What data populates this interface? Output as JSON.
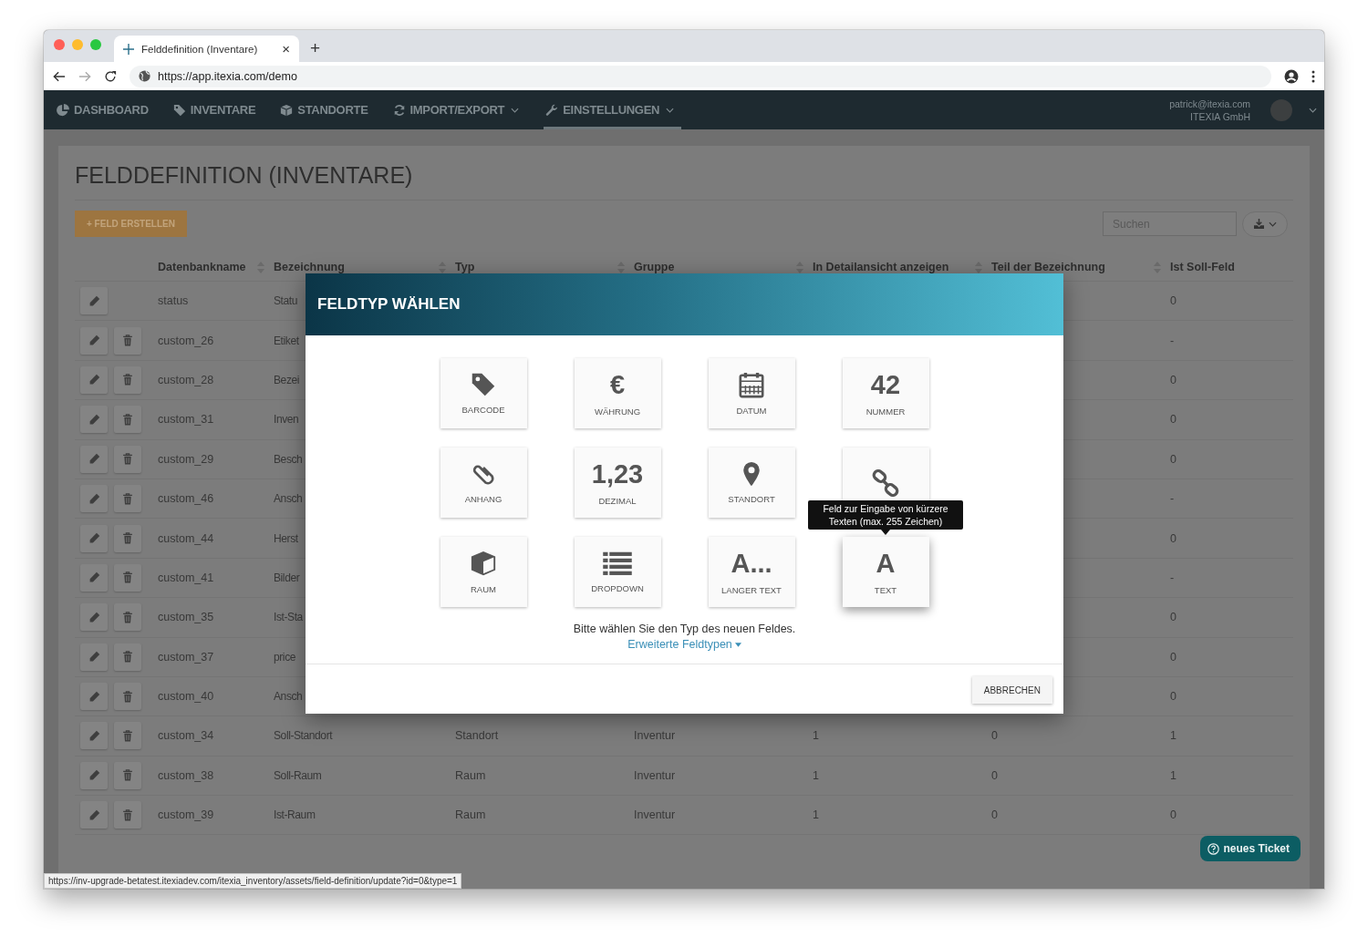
{
  "browser": {
    "tab_title": "Felddefinition (Inventare)",
    "tab_close": "×",
    "new_tab": "+",
    "url": "https://app.itexia.com/demo",
    "status_url": "https://inv-upgrade-betatest.itexiadev.com/itexia_inventory/assets/field-definition/update?id=0&type=1"
  },
  "nav": {
    "items": [
      {
        "label": "DASHBOARD",
        "kind": "dashboard",
        "dropdown": false,
        "selected": false
      },
      {
        "label": "INVENTARE",
        "kind": "inventory",
        "dropdown": false,
        "selected": false
      },
      {
        "label": "STANDORTE",
        "kind": "locations",
        "dropdown": false,
        "selected": false
      },
      {
        "label": "IMPORT/EXPORT",
        "kind": "sync",
        "dropdown": true,
        "selected": false
      },
      {
        "label": "EINSTELLUNGEN",
        "kind": "settings",
        "dropdown": true,
        "selected": true
      }
    ],
    "user": {
      "email": "patrick@itexia.com",
      "company": "ITEXIA GmbH"
    }
  },
  "page": {
    "title": "FELDDEFINITION (INVENTARE)",
    "create_button": "+ FELD ERSTELLEN",
    "search": {
      "placeholder": "Suchen"
    }
  },
  "table": {
    "columns": [
      {
        "label": "Datenbankname",
        "sortable": true
      },
      {
        "label": "Bezeichnung",
        "sortable": true
      },
      {
        "label": "Typ",
        "sortable": true
      },
      {
        "label": "Gruppe",
        "sortable": true
      },
      {
        "label": "In Detailansicht anzeigen",
        "sortable": true
      },
      {
        "label": "Teil der Bezeichnung",
        "sortable": true
      },
      {
        "label": "Ist Soll-Feld",
        "sortable": false
      }
    ],
    "rows": [
      {
        "name": "status",
        "label": "Statu",
        "target": "0",
        "deletable": false
      },
      {
        "name": "custom_26",
        "label": "Etiket",
        "target": "-",
        "deletable": true
      },
      {
        "name": "custom_28",
        "label": "Bezei",
        "target": "0",
        "deletable": true
      },
      {
        "name": "custom_31",
        "label": "Inven",
        "target": "0",
        "deletable": true
      },
      {
        "name": "custom_29",
        "label": "Besch",
        "target": "0",
        "deletable": true
      },
      {
        "name": "custom_46",
        "label": "Ansch",
        "target": "-",
        "deletable": true
      },
      {
        "name": "custom_44",
        "label": "Herst",
        "target": "0",
        "deletable": true
      },
      {
        "name": "custom_41",
        "label": "Bilder",
        "target": "-",
        "deletable": true
      },
      {
        "name": "custom_35",
        "label": "Ist-Sta",
        "target": "0",
        "deletable": true
      },
      {
        "name": "custom_37",
        "label": "price",
        "target": "0",
        "deletable": true
      },
      {
        "name": "custom_40",
        "label": "Ansch",
        "target": "0",
        "deletable": true
      },
      {
        "name": "custom_34",
        "label": "Soll-Standort",
        "type": "Standort",
        "group": "Inventur",
        "detail": "1",
        "part": "0",
        "target": "1",
        "deletable": true
      },
      {
        "name": "custom_38",
        "label": "Soll-Raum",
        "type": "Raum",
        "group": "Inventur",
        "detail": "1",
        "part": "0",
        "target": "1",
        "deletable": true
      },
      {
        "name": "custom_39",
        "label": "Ist-Raum",
        "type": "Raum",
        "group": "Inventur",
        "detail": "1",
        "part": "0",
        "target": "0",
        "deletable": true
      }
    ]
  },
  "modal": {
    "title": "FELDTYP WÄHLEN",
    "tiles": [
      {
        "kind": "tag",
        "label": "BARCODE",
        "hovered": false
      },
      {
        "kind": "glyph",
        "glyph": "€",
        "label": "WÄHRUNG",
        "hovered": false
      },
      {
        "kind": "calendar",
        "label": "DATUM",
        "hovered": false
      },
      {
        "kind": "glyph",
        "glyph": "42",
        "label": "NUMMER",
        "hovered": false
      },
      {
        "kind": "paperclip",
        "label": "ANHANG",
        "hovered": false
      },
      {
        "kind": "glyph",
        "glyph": "1,23",
        "label": "DEZIMAL",
        "hovered": false
      },
      {
        "kind": "pin",
        "label": "STANDORT",
        "hovered": false
      },
      {
        "kind": "link",
        "hovered": false
      },
      {
        "kind": "cube",
        "label": "RAUM",
        "hovered": false
      },
      {
        "kind": "list",
        "label": "DROPDOWN",
        "hovered": false
      },
      {
        "kind": "glyph",
        "glyph": "A...",
        "label": "LANGER TEXT",
        "hovered": false
      },
      {
        "kind": "glyph",
        "glyph": "A",
        "label": "TEXT",
        "hovered": true,
        "tooltip": "Feld zur Eingabe von kürzere Texten (max. 255 Zeichen)"
      }
    ],
    "hint": "Bitte wählen Sie den Typ des neuen Feldes.",
    "link": "Erweiterte Feldtypen",
    "cancel": "ABBRECHEN"
  },
  "help_button": "neues Ticket"
}
